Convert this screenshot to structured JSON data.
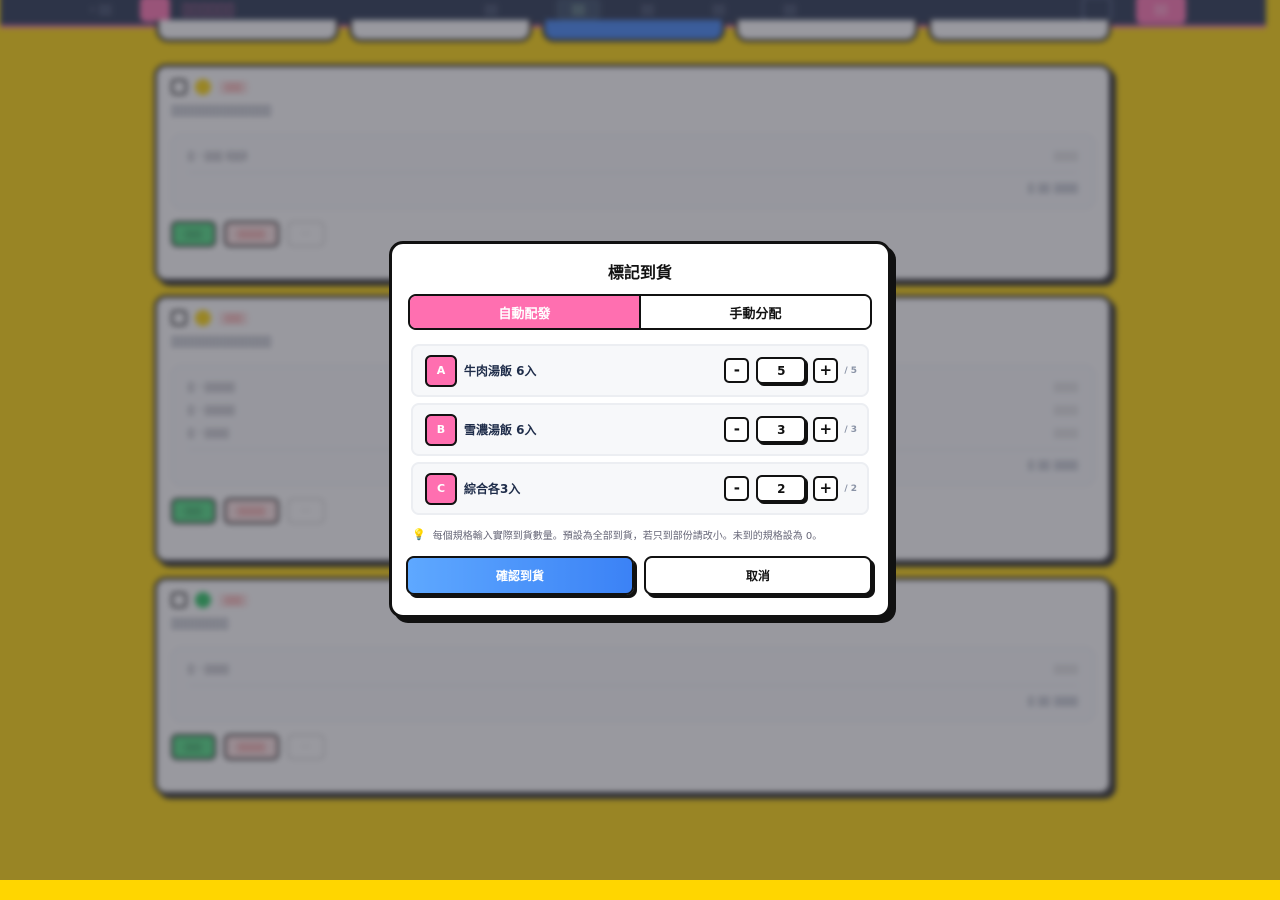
{
  "modal": {
    "title": "標記到貨",
    "tabs": [
      {
        "label": "自動配發",
        "active": true
      },
      {
        "label": "手動分配",
        "active": false
      }
    ],
    "specs": [
      {
        "letter": "A",
        "name": "牛肉湯飯 6入",
        "qty": "5",
        "total": "/ 5",
        "minus": "-",
        "plus": "+"
      },
      {
        "letter": "B",
        "name": "雪濃湯飯 6入",
        "qty": "3",
        "total": "/ 3",
        "minus": "-",
        "plus": "+"
      },
      {
        "letter": "C",
        "name": "綜合各3入",
        "qty": "2",
        "total": "/ 2",
        "minus": "-",
        "plus": "+"
      }
    ],
    "hint_icon": "lightbulb-icon",
    "hint": "每個規格輸入實際到貨數量。預設為全部到貨，若只到部份請改小。未到的規格設為 0。",
    "confirm_label": "確認到貨",
    "cancel_label": "取消"
  },
  "colors": {
    "accent_pink": "#ff6fb0",
    "confirm_blue": "#3b82f6",
    "page_yellow": "#ffd600",
    "border": "#111111"
  }
}
